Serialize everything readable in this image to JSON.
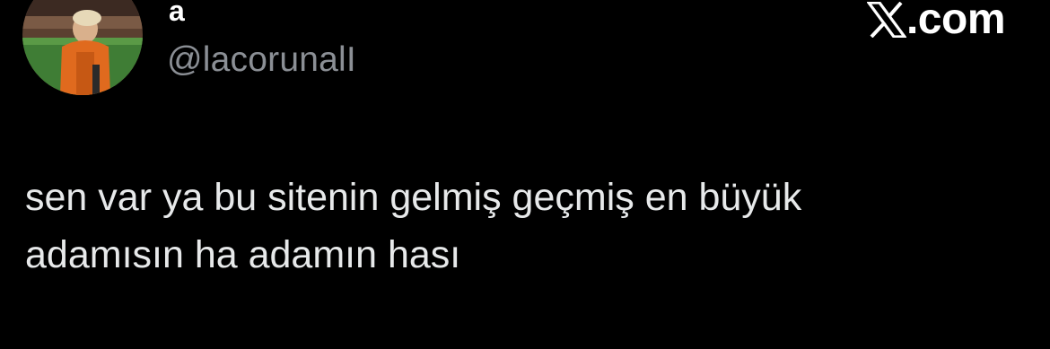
{
  "author": {
    "display_name": "a",
    "handle": "@lacorunalI",
    "avatar_icon": "profile-photo"
  },
  "brand": {
    "icon": "x-logo-icon",
    "text": ".com"
  },
  "tweet": {
    "lines": [
      "sen var ya bu sitenin gelmiş geçmiş en büyük",
      "adamısın ha adamın hası"
    ]
  },
  "colors": {
    "background": "#000000",
    "primary_text": "#e7e9ea",
    "secondary_text": "#8b8f95"
  }
}
